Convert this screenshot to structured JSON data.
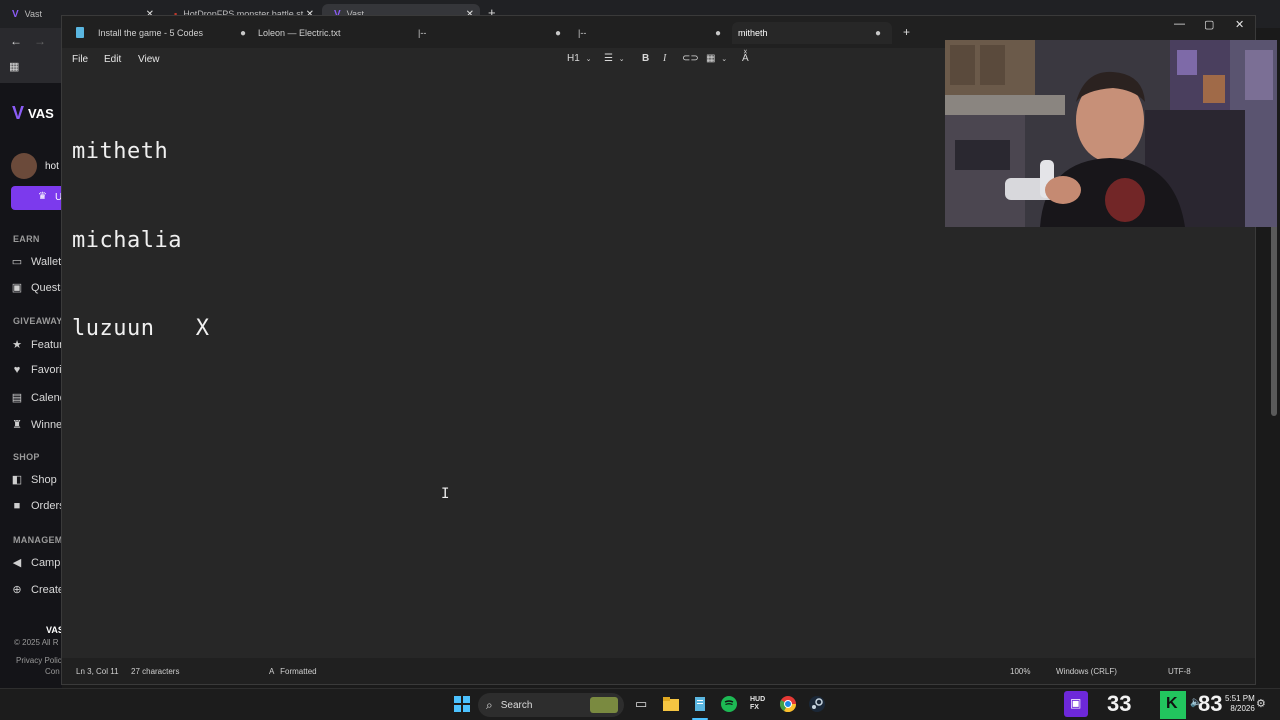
{
  "browser": {
    "tabs": [
      {
        "label": "Vast"
      },
      {
        "label": "HotDropFPS monster battle st..."
      },
      {
        "label": "Vast"
      }
    ],
    "new_tab": "+"
  },
  "vast": {
    "logo": "VAS",
    "username": "hot",
    "upgrade_label": "U",
    "sections": {
      "earn": "EARN",
      "giveaways": "GIVEAWAYS",
      "shop": "SHOP",
      "manage": "MANAGEME"
    },
    "items": {
      "wallet": "Wallet",
      "quests": "Quests",
      "featured": "Featur",
      "favorites": "Favori",
      "calendar": "Calend",
      "winners": "Winne",
      "shop": "Shop",
      "orders": "Orders",
      "campaigns": "Camp",
      "create": "Create"
    },
    "footer": {
      "brand": "VAS",
      "copyright": "© 2025 All R",
      "privacy": "Privacy Polic",
      "conduct": "Con"
    }
  },
  "notepad": {
    "tabs": [
      {
        "label": "Install the game - 5 Codes"
      },
      {
        "label": "Loleon — Electric.txt"
      },
      {
        "label": "|--"
      },
      {
        "label": "|--"
      },
      {
        "label": "mitheth"
      }
    ],
    "add_tab": "+",
    "menu": {
      "file": "File",
      "edit": "Edit",
      "view": "View"
    },
    "format": {
      "heading": "H1"
    },
    "content": {
      "line1": "mitheth",
      "line2": "michalia",
      "line3": "luzuun   X"
    },
    "status": {
      "position": "Ln 3, Col 11",
      "chars": "27 characters",
      "mode": "Formatted",
      "zoom": "100%",
      "line_ending": "Windows (CRLF)",
      "encoding": "UTF-8"
    }
  },
  "taskbar": {
    "search_label": "Search",
    "widget_left": "33",
    "widget_right": "83",
    "clock_time": "5:51 PM",
    "clock_date": "8/2026"
  }
}
